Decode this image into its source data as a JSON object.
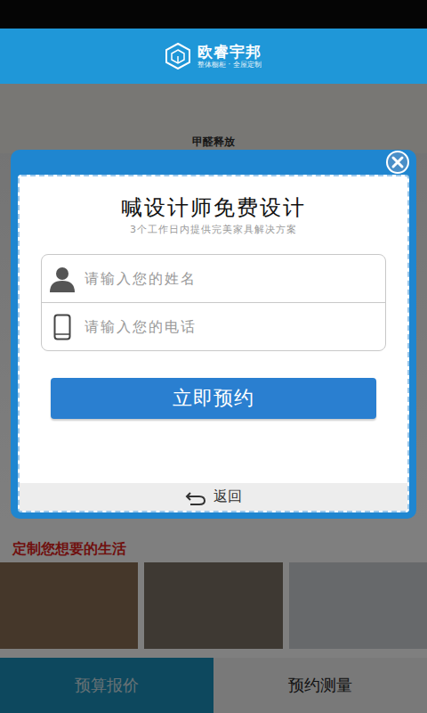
{
  "header": {
    "brand": "欧睿宇邦",
    "tagline": "整体橱柜 · 全屋定制"
  },
  "background": {
    "caption": "甲醛释放",
    "slogan": "定制您想要的生活"
  },
  "bottom_tabs": [
    {
      "label": "预算报价",
      "selected": true
    },
    {
      "label": "预约测量",
      "selected": false
    }
  ],
  "dialog": {
    "title": "喊设计师免费设计",
    "subtitle": "3个工作日内提供完美家具解决方案",
    "fields": [
      {
        "placeholder": "请输入您的姓名",
        "kind": "name"
      },
      {
        "placeholder": "请输入您的电话",
        "kind": "phone"
      }
    ],
    "submit": "立即预约",
    "back": "返回"
  }
}
